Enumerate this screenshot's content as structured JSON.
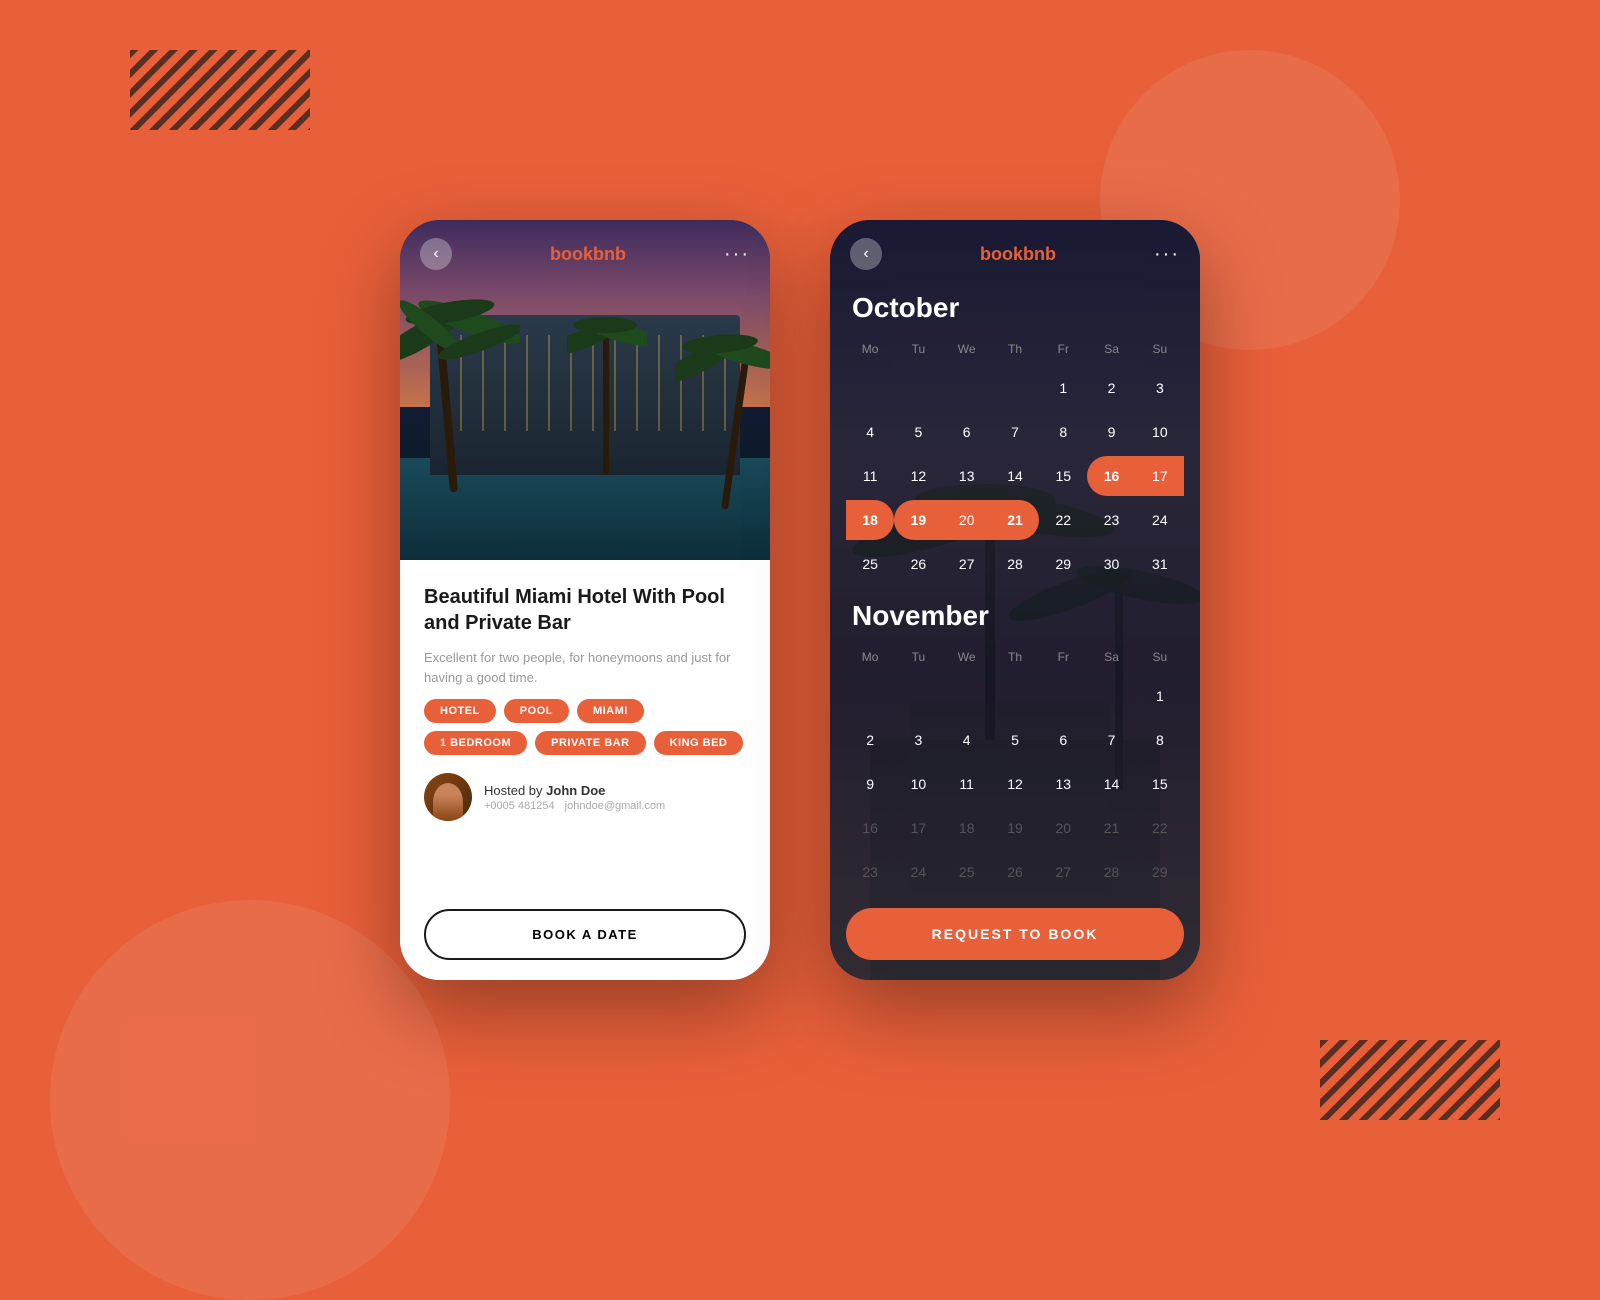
{
  "app": {
    "name_prefix": "book",
    "name_suffix": "bnb"
  },
  "background": {
    "color": "#E8603A"
  },
  "phone1": {
    "back_button": "‹",
    "dots_button": "···",
    "hotel": {
      "title": "Beautiful Miami Hotel With Pool and Private Bar",
      "description": "Excellent for two people, for honeymoons and just for having a good time.",
      "tags": [
        "HOTEL",
        "POOL",
        "MIAMI",
        "1 BEDROOM",
        "PRIVATE BAR",
        "KING BED"
      ],
      "host_label": "Hosted by",
      "host_name": "John Doe",
      "host_phone": "+0005 481254",
      "host_email": "johndoe@gmail.com",
      "book_button": "BOOK A DATE"
    }
  },
  "phone2": {
    "back_button": "‹",
    "dots_button": "···",
    "calendar": {
      "october_title": "October",
      "november_title": "November",
      "weekdays": [
        "Mo",
        "Tu",
        "We",
        "Th",
        "Fr",
        "Sa",
        "Su"
      ],
      "october_days": [
        {
          "num": "",
          "state": "empty"
        },
        {
          "num": "",
          "state": "empty"
        },
        {
          "num": "",
          "state": "empty"
        },
        {
          "num": "",
          "state": "empty"
        },
        {
          "num": "1",
          "state": "normal"
        },
        {
          "num": "2",
          "state": "normal"
        },
        {
          "num": "3",
          "state": "normal"
        },
        {
          "num": "4",
          "state": "normal"
        },
        {
          "num": "5",
          "state": "normal"
        },
        {
          "num": "6",
          "state": "normal"
        },
        {
          "num": "7",
          "state": "normal"
        },
        {
          "num": "8",
          "state": "normal"
        },
        {
          "num": "9",
          "state": "normal"
        },
        {
          "num": "10",
          "state": "normal"
        },
        {
          "num": "11",
          "state": "normal"
        },
        {
          "num": "12",
          "state": "normal"
        },
        {
          "num": "13",
          "state": "normal"
        },
        {
          "num": "14",
          "state": "normal"
        },
        {
          "num": "15",
          "state": "normal"
        },
        {
          "num": "16",
          "state": "selected-start"
        },
        {
          "num": "17",
          "state": "selected-middle"
        },
        {
          "num": "18",
          "state": "selected-end"
        },
        {
          "num": "19",
          "state": "selected-start"
        },
        {
          "num": "20",
          "state": "selected-middle"
        },
        {
          "num": "21",
          "state": "selected-end"
        },
        {
          "num": "22",
          "state": "normal"
        },
        {
          "num": "23",
          "state": "normal"
        },
        {
          "num": "24",
          "state": "normal"
        },
        {
          "num": "25",
          "state": "normal"
        },
        {
          "num": "26",
          "state": "normal"
        },
        {
          "num": "27",
          "state": "normal"
        },
        {
          "num": "28",
          "state": "normal"
        },
        {
          "num": "29",
          "state": "normal"
        },
        {
          "num": "30",
          "state": "normal"
        },
        {
          "num": "31",
          "state": "normal"
        }
      ],
      "november_days": [
        {
          "num": "",
          "state": "empty"
        },
        {
          "num": "",
          "state": "empty"
        },
        {
          "num": "",
          "state": "empty"
        },
        {
          "num": "",
          "state": "empty"
        },
        {
          "num": "",
          "state": "empty"
        },
        {
          "num": "",
          "state": "empty"
        },
        {
          "num": "1",
          "state": "normal"
        },
        {
          "num": "2",
          "state": "normal"
        },
        {
          "num": "3",
          "state": "normal"
        },
        {
          "num": "4",
          "state": "normal"
        },
        {
          "num": "5",
          "state": "normal"
        },
        {
          "num": "6",
          "state": "normal"
        },
        {
          "num": "7",
          "state": "normal"
        },
        {
          "num": "8",
          "state": "normal"
        },
        {
          "num": "9",
          "state": "normal"
        },
        {
          "num": "10",
          "state": "normal"
        },
        {
          "num": "11",
          "state": "normal"
        },
        {
          "num": "12",
          "state": "normal"
        },
        {
          "num": "13",
          "state": "normal"
        },
        {
          "num": "14",
          "state": "normal"
        },
        {
          "num": "15",
          "state": "normal"
        },
        {
          "num": "16",
          "state": "muted"
        },
        {
          "num": "17",
          "state": "muted"
        },
        {
          "num": "18",
          "state": "muted"
        },
        {
          "num": "19",
          "state": "muted"
        },
        {
          "num": "20",
          "state": "muted"
        },
        {
          "num": "21",
          "state": "muted"
        },
        {
          "num": "22",
          "state": "muted"
        },
        {
          "num": "23",
          "state": "muted"
        },
        {
          "num": "24",
          "state": "muted"
        },
        {
          "num": "25",
          "state": "muted"
        },
        {
          "num": "26",
          "state": "muted"
        },
        {
          "num": "27",
          "state": "muted"
        },
        {
          "num": "28",
          "state": "muted"
        },
        {
          "num": "29",
          "state": "muted"
        }
      ],
      "request_button": "REQUEST TO BOOK"
    }
  }
}
